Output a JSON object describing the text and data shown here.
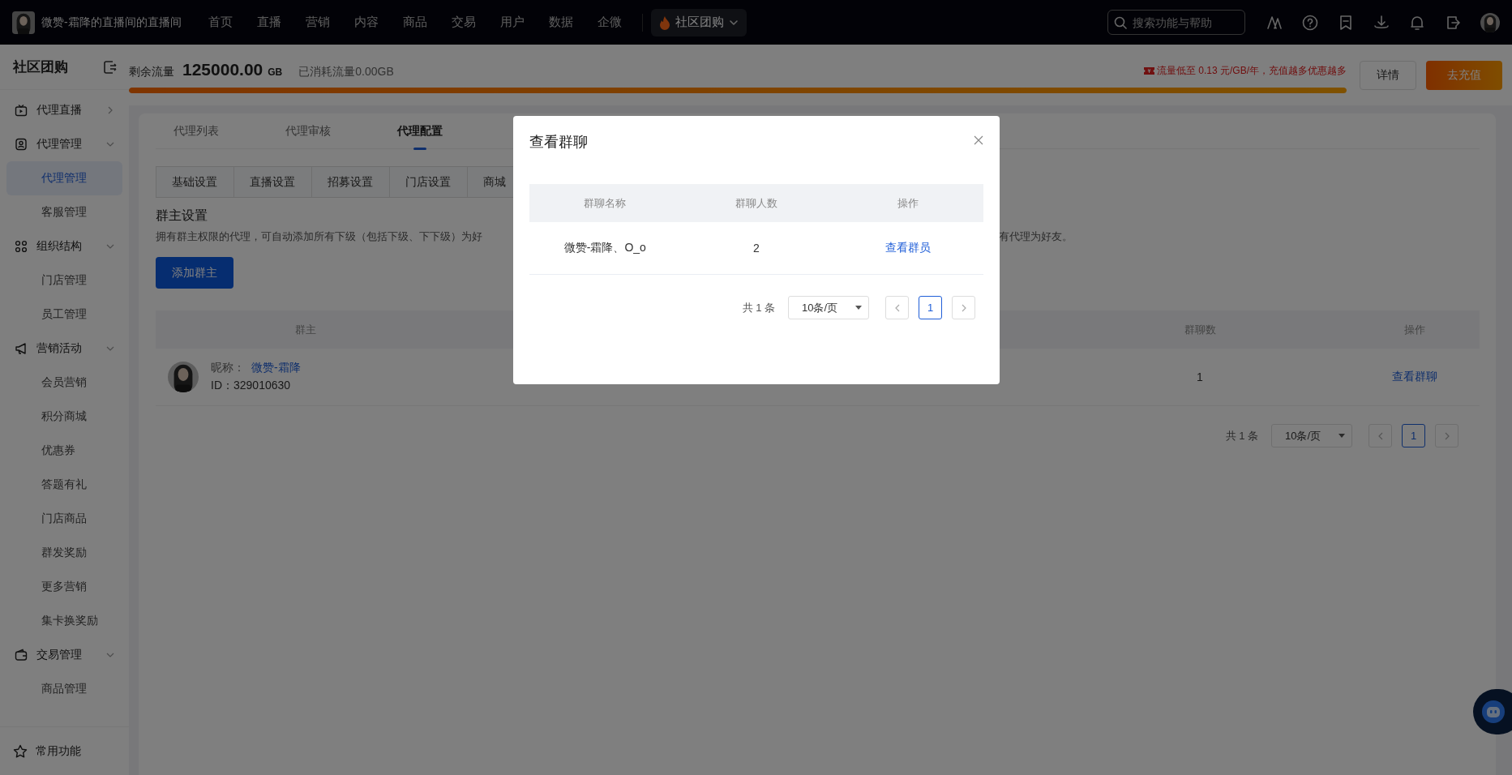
{
  "top_bar": {
    "store_name": "微赞-霜降的直播间的直播间",
    "nav": [
      {
        "label": "首页",
        "selected": false
      },
      {
        "label": "直播",
        "selected": false
      },
      {
        "label": "营销",
        "selected": false
      },
      {
        "label": "内容",
        "selected": false
      },
      {
        "label": "商品",
        "selected": false
      },
      {
        "label": "交易",
        "selected": false
      },
      {
        "label": "用户",
        "selected": false
      },
      {
        "label": "数据",
        "selected": false
      },
      {
        "label": "企微",
        "selected": false
      }
    ],
    "app_switch": {
      "label": "社区团购"
    },
    "search": {
      "placeholder": "搜索功能与帮助"
    }
  },
  "sidebar": {
    "title": "社区团购",
    "groups": [
      {
        "label": "代理直播",
        "expanded": false
      },
      {
        "label": "代理管理",
        "expanded": true,
        "children": [
          {
            "label": "代理管理",
            "selected": true
          },
          {
            "label": "客服管理",
            "selected": false
          }
        ]
      },
      {
        "label": "组织结构",
        "expanded": true,
        "children": [
          {
            "label": "门店管理",
            "selected": false
          },
          {
            "label": "员工管理",
            "selected": false
          }
        ]
      },
      {
        "label": "营销活动",
        "expanded": true,
        "children": [
          {
            "label": "会员营销",
            "selected": false
          },
          {
            "label": "积分商城",
            "selected": false
          },
          {
            "label": "优惠券",
            "selected": false
          },
          {
            "label": "答题有礼",
            "selected": false
          },
          {
            "label": "门店商品",
            "selected": false
          },
          {
            "label": "群发奖励",
            "selected": false
          },
          {
            "label": "更多营销",
            "selected": false
          },
          {
            "label": "集卡换奖励",
            "selected": false
          }
        ]
      },
      {
        "label": "交易管理",
        "expanded": true,
        "children": [
          {
            "label": "商品管理",
            "selected": false
          }
        ]
      }
    ],
    "footer_item": {
      "label": "常用功能"
    }
  },
  "traffic": {
    "remaining_label": "剩余流量",
    "remaining_value": "125000.00",
    "remaining_unit": "GB",
    "consumed": "已消耗流量0.00GB",
    "level": 1,
    "promo": "流量低至 0.13 元/GB/年，充值越多优惠越多",
    "buttons": [
      {
        "label": "详情",
        "kind": "default"
      },
      {
        "label": "去充值",
        "kind": "primary"
      }
    ]
  },
  "main": {
    "tabs": [
      {
        "label": "代理列表",
        "selected": false
      },
      {
        "label": "代理审核",
        "selected": false
      },
      {
        "label": "代理配置",
        "selected": true
      }
    ],
    "sub_tabs": [
      {
        "label": "基础设置",
        "selected": false
      },
      {
        "label": "直播设置",
        "selected": false
      },
      {
        "label": "招募设置",
        "selected": false
      },
      {
        "label": "门店设置",
        "selected": false
      },
      {
        "label": "商城",
        "selected": false
      }
    ],
    "section_title": "群主设置",
    "description_parts": [
      "拥有群主权限的代理，可自动添加所有下级（包括下级、下下级）为好",
      "有代理为好友。"
    ],
    "add_button": "添加群主",
    "table": {
      "columns": [
        "群主",
        "群聊数",
        "操作"
      ],
      "rows": [
        {
          "nickname_label": "昵称：",
          "nickname": "微赞-霜降",
          "id_text": "ID：329010630",
          "group_count": "1",
          "action": "查看群聊"
        }
      ]
    },
    "pagination": {
      "total": "共 1 条",
      "page_size": "10条/页",
      "pages": [
        {
          "label": "1",
          "selected": true
        }
      ]
    }
  },
  "modal": {
    "title": "查看群聊",
    "columns": [
      "群聊名称",
      "群聊人数",
      "操作"
    ],
    "rows": [
      {
        "name": "微赞-霜降、O_o",
        "members": "2",
        "action": "查看群员"
      }
    ],
    "pagination": {
      "total": "共 1 条",
      "page_size": "10条/页",
      "pages": [
        {
          "label": "1",
          "selected": true
        }
      ]
    }
  }
}
